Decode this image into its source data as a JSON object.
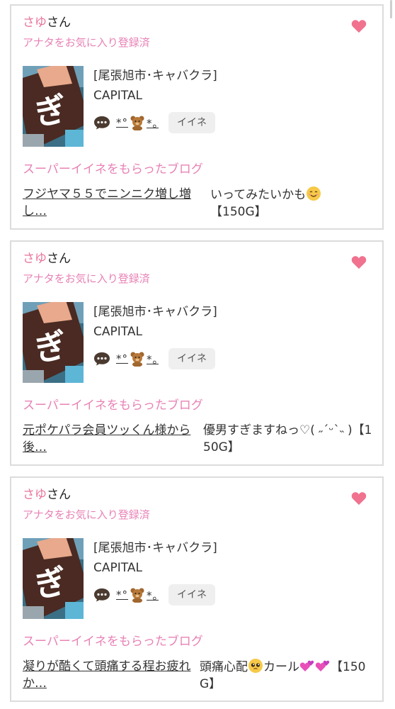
{
  "cards": [
    {
      "user_name": "さゆ",
      "user_suffix": "さん",
      "favorite_status": "アナタをお気に入り登録済",
      "shop_area": "[尾張旭市･キャバクラ]",
      "shop_name": "CAPITAL",
      "cast_prefix": "*°",
      "cast_suffix": "*｡",
      "iine_label": "イイネ",
      "blog_heading": "スーパーイイネをもらったブログ",
      "blog_title": "フジヤマ５５でニンニク増し増し…",
      "comment_text": "いってみたいかも",
      "comment_emoji": "smiling-face-emoji",
      "comment_tail": "【150G】"
    },
    {
      "user_name": "さゆ",
      "user_suffix": "さん",
      "favorite_status": "アナタをお気に入り登録済",
      "shop_area": "[尾張旭市･キャバクラ]",
      "shop_name": "CAPITAL",
      "cast_prefix": "*°",
      "cast_suffix": "*｡",
      "iine_label": "イイネ",
      "blog_heading": "スーパーイイネをもらったブログ",
      "blog_title": "元ポケパラ会員ツッくん様から後…",
      "comment_text": "優男すぎますねっ♡( ˶ˊᵕˋ˵ )",
      "comment_tail": "【150G】"
    },
    {
      "user_name": "さゆ",
      "user_suffix": "さん",
      "favorite_status": "アナタをお気に入り登録済",
      "shop_area": "[尾張旭市･キャバクラ]",
      "shop_name": "CAPITAL",
      "cast_prefix": "*°",
      "cast_suffix": "*｡",
      "iine_label": "イイネ",
      "blog_heading": "スーパーイイネをもらったブログ",
      "blog_title": "凝りが酷くて頭痛する程お疲れか…",
      "comment_text": "頭痛心配",
      "comment_mid": "カール",
      "comment_tail": "【150G】"
    }
  ],
  "colors": {
    "accent_pink": "#e882b5",
    "name_pink": "#e8749a",
    "heart": "#f0728f",
    "border": "#dcdcdc"
  },
  "icons": [
    "heart-icon",
    "chat-bubble-icon",
    "bear-emoji",
    "pleading-face-emoji",
    "two-hearts-emoji"
  ]
}
